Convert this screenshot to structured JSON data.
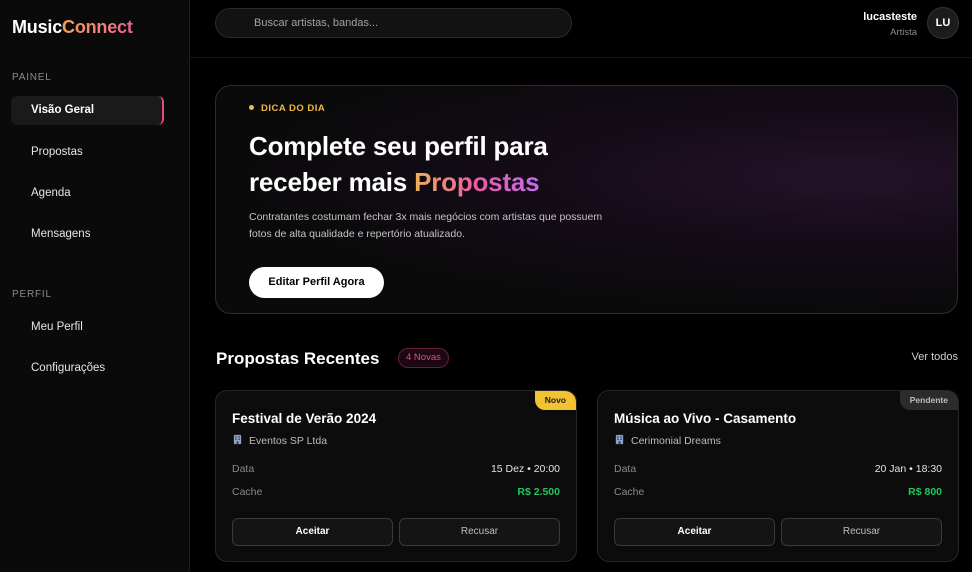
{
  "app": {
    "logo_main": "Music",
    "logo_accent": "Connect"
  },
  "sidebar": {
    "section_painel": "PAINEL",
    "painel_items": [
      {
        "label": "Visão Geral",
        "active": true
      },
      {
        "label": "Propostas",
        "active": false
      },
      {
        "label": "Agenda",
        "active": false
      },
      {
        "label": "Mensagens",
        "active": false
      }
    ],
    "section_perfil": "PERFIL",
    "perfil_items": [
      {
        "label": "Meu Perfil"
      },
      {
        "label": "Configurações"
      }
    ]
  },
  "topbar": {
    "search_placeholder": "Buscar artistas, bandas...",
    "user_name": "lucasteste",
    "user_role": "Artista",
    "avatar_initials": "LU"
  },
  "hero": {
    "tip_label": "DICA DO DIA",
    "title_line1": "Complete seu perfil para",
    "title_line2_plain": "receber mais ",
    "title_line2_highlight": "Propostas",
    "description": "Contratantes costumam fechar 3x mais negócios com artistas que possuem fotos de alta qualidade e repertório atualizado.",
    "button_label": "Editar Perfil Agora"
  },
  "proposals": {
    "title": "Propostas Recentes",
    "badge": "4 Novas",
    "see_all": "Ver todos",
    "cards": [
      {
        "status": "Novo",
        "title": "Festival de Verão 2024",
        "company": "Eventos SP Ltda",
        "date_label": "Data",
        "date_value": "15 Dez • 20:00",
        "fee_label": "Cache",
        "fee_value": "R$ 2.500",
        "accept_label": "Aceitar",
        "reject_label": "Recusar"
      },
      {
        "status": "Pendente",
        "title": "Música ao Vivo - Casamento",
        "company": "Cerimonial Dreams",
        "date_label": "Data",
        "date_value": "20 Jan • 18:30",
        "fee_label": "Cache",
        "fee_value": "R$ 800",
        "accept_label": "Aceitar",
        "reject_label": "Recusar"
      }
    ]
  },
  "colors": {
    "accent_pink": "#e54a86",
    "tip_yellow": "#f0b84a",
    "money_green": "#22c55e",
    "status_new": "#f2c230"
  },
  "icons": {
    "company": "building-icon"
  }
}
